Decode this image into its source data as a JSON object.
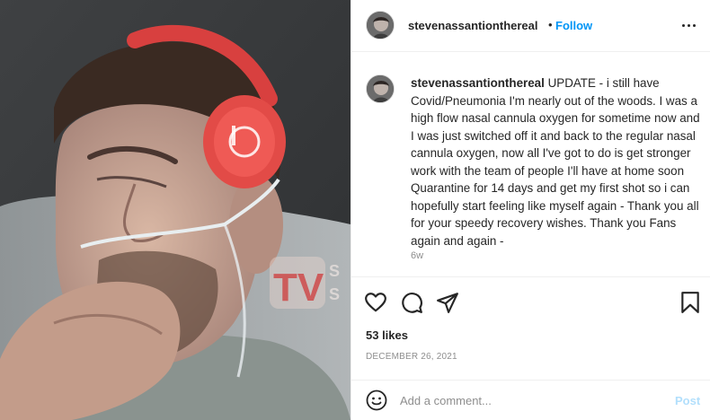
{
  "colors": {
    "follow_blue": "#0095f6",
    "post_disabled": "#b2dffc",
    "muted_text": "#8e8e8e",
    "headphone_red": "#d8403f"
  },
  "photo": {
    "watermark_letters": "TV",
    "watermark_partial": "S\nS"
  },
  "header": {
    "username": "stevenassantionthereal",
    "separator": "•",
    "follow_label": "Follow",
    "more_icon": "more-horizontal-icon"
  },
  "post": {
    "caption_username": "stevenassantionthereal",
    "caption_text": "UPDATE - i still have Covid/Pneumonia I'm nearly out of the woods. I was a high flow nasal cannula oxygen for sometime now and I was just switched off it and back to the regular nasal cannula oxygen, now all I've got to do is get stronger work with the team of people I'll have at home soon Quarantine for 14 days and get my first shot so i can hopefully start feeling like myself again - Thank you all for your speedy recovery wishes. Thank you Fans again and again -",
    "time_ago": "6w",
    "likes": "53 likes",
    "date": "DECEMBER 26, 2021"
  },
  "actions": {
    "icons": [
      "heart-icon",
      "comment-icon",
      "share-icon",
      "bookmark-icon"
    ]
  },
  "comment": {
    "placeholder": "Add a comment...",
    "post_label": "Post",
    "emoji_icon": "emoji-icon"
  }
}
